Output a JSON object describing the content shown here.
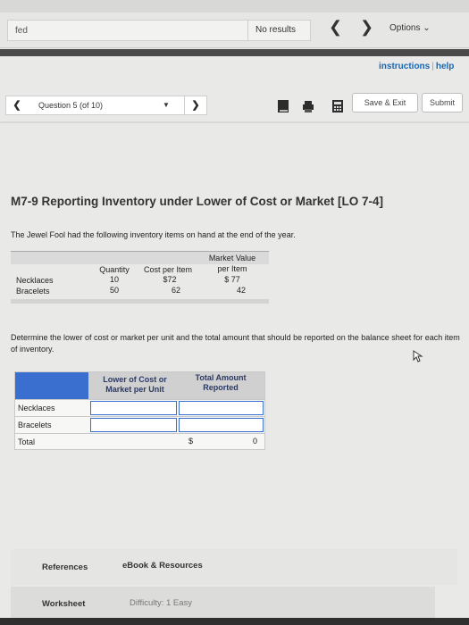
{
  "browser": {
    "find_text": "fed",
    "find_results": "No results",
    "options_label": "Options"
  },
  "header": {
    "instructions": "instructions",
    "help": "help"
  },
  "nav": {
    "question_label": "Question 5 (of 10)",
    "save_exit": "Save & Exit",
    "submit": "Submit"
  },
  "question": {
    "title": "M7-9 Reporting Inventory under Lower of Cost or Market [LO 7-4]",
    "intro": "The Jewel Fool had the following inventory items on hand at the end of the year.",
    "determine": "Determine the lower of cost or market per unit and the total amount that should be reported on the balance sheet for each item of inventory."
  },
  "inventory_table": {
    "headers": {
      "quantity": "Quantity",
      "cost_per_item": "Cost per Item",
      "market_value_1": "Market Value",
      "market_value_2": "per Item"
    },
    "rows": [
      {
        "item": "Necklaces",
        "quantity": "10",
        "cost": "$72",
        "market": "$ 77"
      },
      {
        "item": "Bracelets",
        "quantity": "50",
        "cost": "62",
        "market": "42"
      }
    ]
  },
  "answer_table": {
    "col1_line1": "Lower of Cost or",
    "col1_line2": "Market per Unit",
    "col2_line1": "Total Amount",
    "col2_line2": "Reported",
    "rows": [
      "Necklaces",
      "Bracelets"
    ],
    "total_label": "Total",
    "total_currency": "$",
    "total_value": "0"
  },
  "footer": {
    "references": "References",
    "ebook": "eBook & Resources",
    "worksheet": "Worksheet",
    "difficulty": "Difficulty: 1 Easy"
  }
}
